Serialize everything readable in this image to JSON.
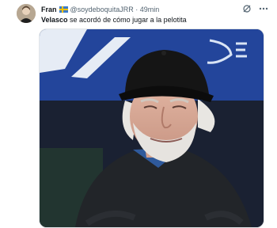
{
  "tweet": {
    "display_name": "Fran",
    "handle": "@soydeboquitaJRR",
    "separator": "·",
    "time": "49min",
    "text_bold": "Velasco",
    "text_rest": "se acordó de cómo jugar a la pelotita"
  },
  "icons": {
    "avatar": "user-avatar",
    "flag": "sweden-flag-icon",
    "grok": "grok-icon",
    "more": "more-options-icon"
  },
  "colors": {
    "text": "#0f1419",
    "secondary": "#536471",
    "banner_blue": "#23459b"
  }
}
